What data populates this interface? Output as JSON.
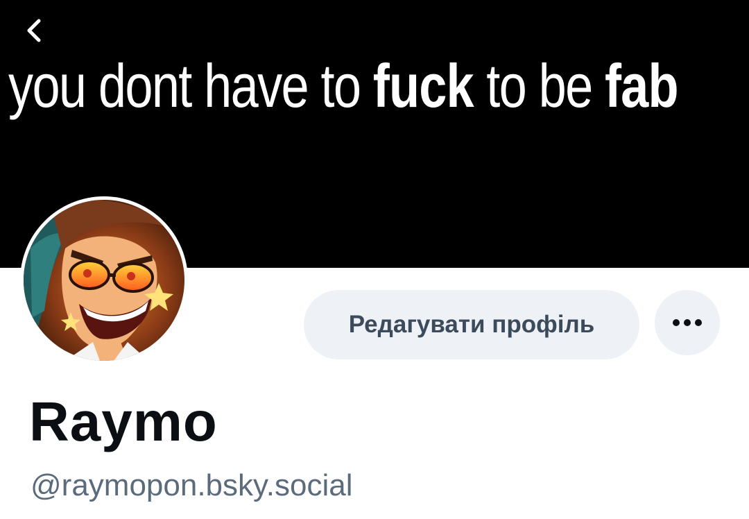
{
  "header": {
    "back_icon": "chevron-left-icon"
  },
  "banner": {
    "background_color": "#000000",
    "text_parts": [
      {
        "text": "you dont have to ",
        "bold": false
      },
      {
        "text": "fuck",
        "bold": true
      },
      {
        "text": " to be ",
        "bold": false
      },
      {
        "text": "fab",
        "bold": true
      }
    ]
  },
  "profile": {
    "display_name": "Raymo",
    "handle": "@raymopon.bsky.social",
    "avatar_icon": "avatar-character-with-sunglasses"
  },
  "actions": {
    "edit_profile_label": "Редагувати профіль",
    "more_icon": "more-dots-icon"
  },
  "colors": {
    "button_bg": "#eef1f5",
    "button_text": "#3c4b5c",
    "name_text": "#0b0f14",
    "handle_text": "#5b6b7c"
  }
}
